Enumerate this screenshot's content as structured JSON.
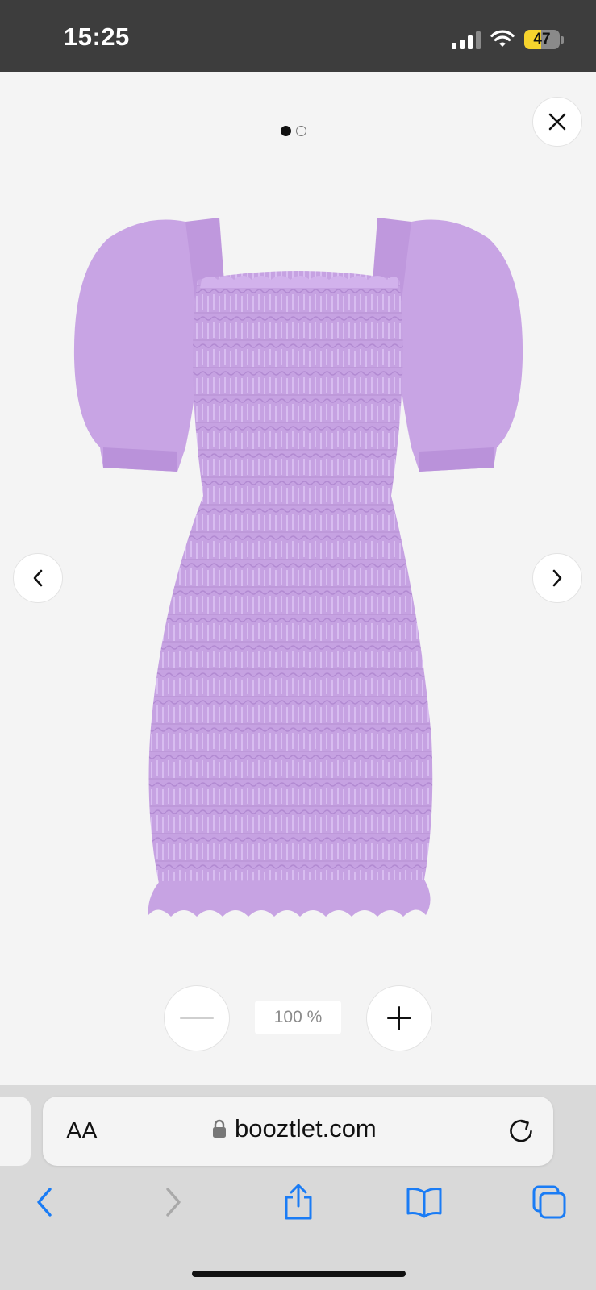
{
  "status_bar": {
    "time": "15:25",
    "battery_level": "47",
    "icons": [
      "cellular-signal-icon",
      "wifi-icon",
      "battery-icon"
    ]
  },
  "viewer": {
    "page_indicator": {
      "current": 1,
      "total": 2
    },
    "close_icon": "close-icon",
    "prev_icon": "chevron-left-icon",
    "next_icon": "chevron-right-icon",
    "zoom": {
      "value": "100 %",
      "minus_icon": "minus-icon",
      "plus_icon": "plus-icon"
    },
    "product_image": {
      "subject": "lilac smocked puff-sleeve mini dress",
      "color": "#c8a4e4"
    }
  },
  "browser": {
    "text_size_label": "AA",
    "url": "booztlet.com",
    "lock_icon": "lock-icon",
    "reload_icon": "reload-icon",
    "nav": [
      "back-icon",
      "forward-icon",
      "share-icon",
      "bookmarks-icon",
      "tabs-icon"
    ],
    "accent_color": "#1a7cf5"
  }
}
